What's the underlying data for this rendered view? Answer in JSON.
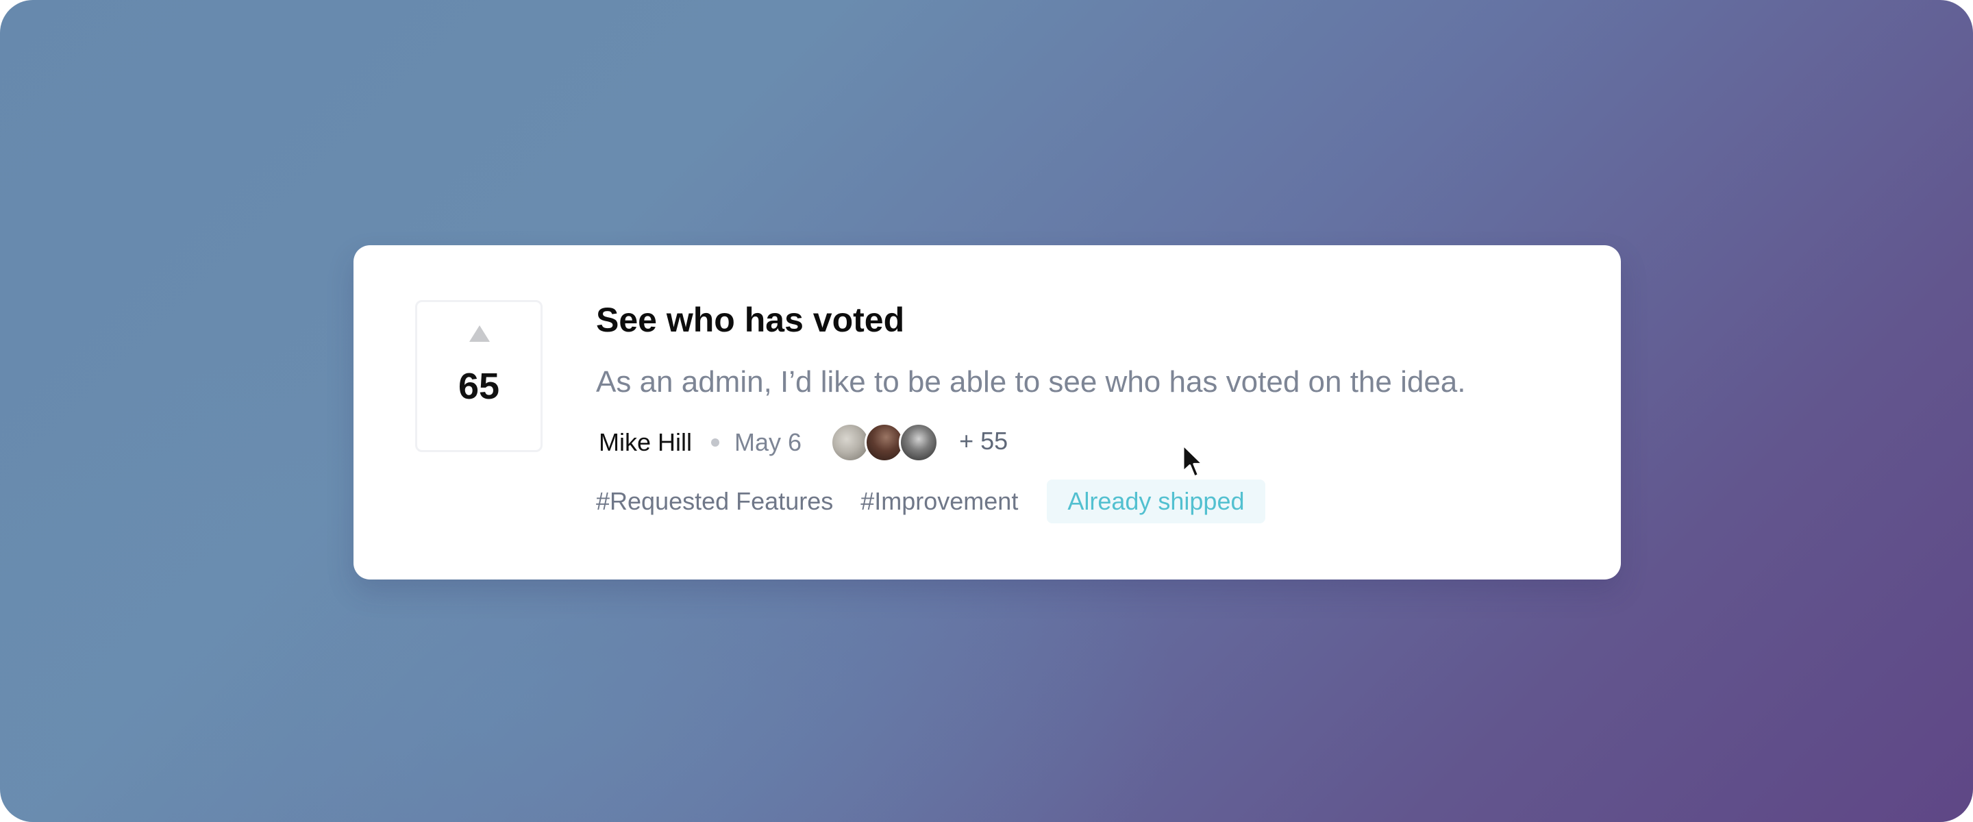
{
  "post": {
    "vote_count": "65",
    "title": "See who has voted",
    "description": "As an admin, I’d like to be able to see who has voted on the idea.",
    "author": "Mike Hill",
    "date": "May 6",
    "voters_more": "+ 55",
    "tags": [
      "#Requested Features",
      "#Improvement"
    ],
    "status": "Already shipped"
  },
  "icons": {
    "upvote": "triangle-up-icon",
    "cursor": "mouse-pointer-icon"
  },
  "colors": {
    "status_text": "#52c0d0",
    "status_bg": "#eef8fb",
    "muted_text": "#7d8595"
  }
}
